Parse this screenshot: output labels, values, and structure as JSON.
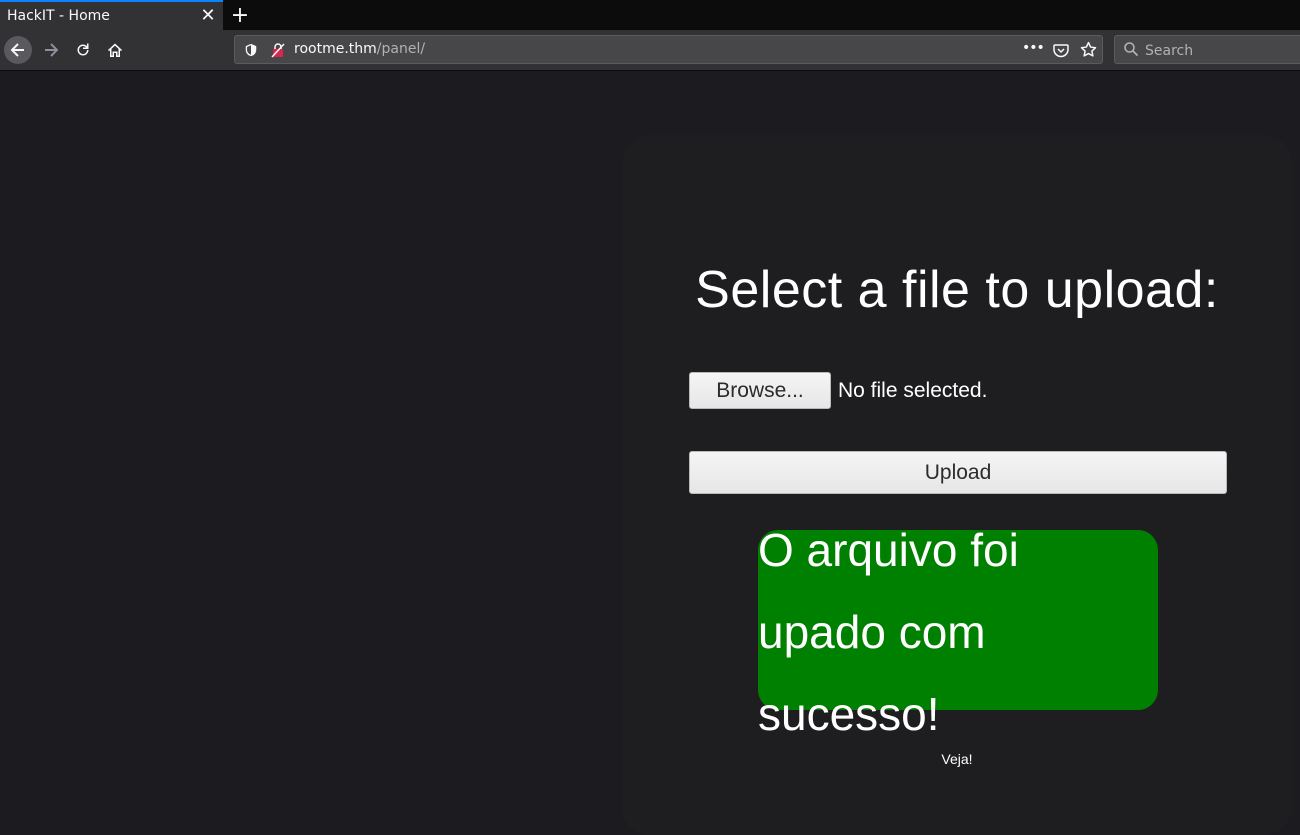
{
  "browser": {
    "tab_title": "HackIT - Home",
    "tab_close": "✕",
    "new_tab": "+",
    "url_host": "rootme.thm",
    "url_path": "/panel/",
    "url_actions": "•••",
    "search_placeholder": "Search"
  },
  "page": {
    "heading": "Select a file to upload:",
    "browse_label": "Browse...",
    "no_file_text": "No file selected.",
    "upload_label": "Upload",
    "success_message": "O arquivo foi upado com sucesso!",
    "link_text": "Veja!"
  },
  "colors": {
    "success_bg": "#008000",
    "page_bg": "#1c1b1f",
    "accent": "#0a84ff"
  }
}
